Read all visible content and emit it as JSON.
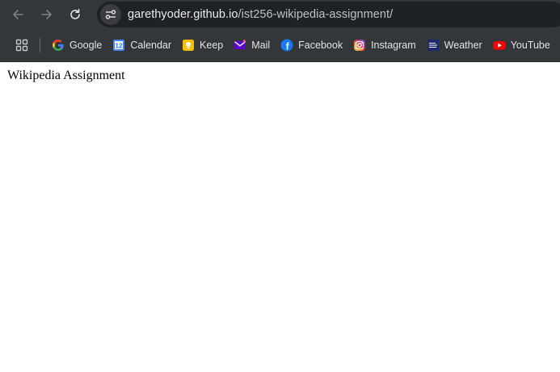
{
  "browser": {
    "url_host": "garethyoder.github.io",
    "url_path": "/ist256-wikipedia-assignment/",
    "back_icon": "arrow-left-icon",
    "forward_icon": "arrow-right-icon",
    "reload_icon": "reload-icon",
    "site_info_icon": "tune-icon"
  },
  "bookmarks": [
    {
      "label": "Google",
      "icon": "google-icon"
    },
    {
      "label": "Calendar",
      "icon": "calendar-icon",
      "icon_text": "12"
    },
    {
      "label": "Keep",
      "icon": "keep-icon"
    },
    {
      "label": "Mail",
      "icon": "mail-icon"
    },
    {
      "label": "Facebook",
      "icon": "facebook-icon",
      "icon_text": "f"
    },
    {
      "label": "Instagram",
      "icon": "instagram-icon"
    },
    {
      "label": "Weather",
      "icon": "weather-icon"
    },
    {
      "label": "YouTube",
      "icon": "youtube-icon"
    }
  ],
  "page": {
    "text": "Wikipedia Assignment"
  },
  "colors": {
    "chrome_bg": "#35363a",
    "omnibox_bg": "#202124",
    "page_bg": "#ffffff"
  }
}
